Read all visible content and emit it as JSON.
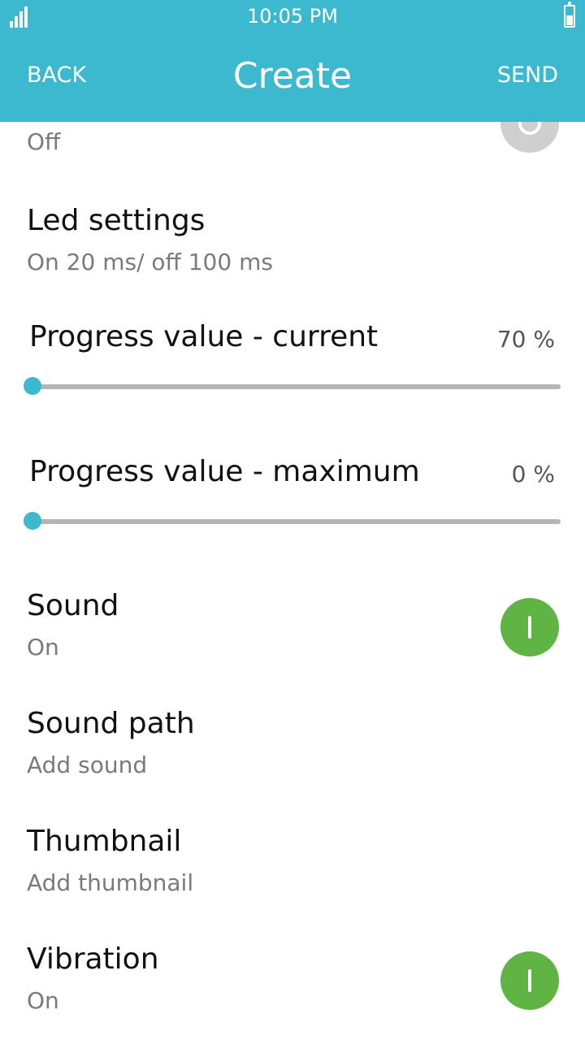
{
  "status_bar": {
    "time": "10:05 PM",
    "signal_icon": "signal-bars-icon",
    "battery_icon": "battery-icon"
  },
  "header": {
    "back_label": "BACK",
    "title": "Create",
    "send_label": "SEND"
  },
  "settings": {
    "partial_item": {
      "value": "Off",
      "toggle": false
    },
    "led": {
      "label": "Led settings",
      "value": "On 20 ms/ off 100 ms"
    },
    "progress_current": {
      "label": "Progress value - current",
      "value": "70 %",
      "slider_fraction": 0
    },
    "progress_maximum": {
      "label": "Progress value - maximum",
      "value": "0 %",
      "slider_fraction": 0
    },
    "sound": {
      "label": "Sound",
      "value": "On",
      "toggle": true
    },
    "sound_path": {
      "label": "Sound path",
      "value": "Add sound"
    },
    "thumbnail": {
      "label": "Thumbnail",
      "value": "Add thumbnail"
    },
    "vibration": {
      "label": "Vibration",
      "value": "On",
      "toggle": true
    }
  },
  "colors": {
    "accent": "#3cb8cf",
    "toggle_on": "#5fb443",
    "toggle_off": "#cfcfcf",
    "subtext": "#7a7a7a"
  }
}
